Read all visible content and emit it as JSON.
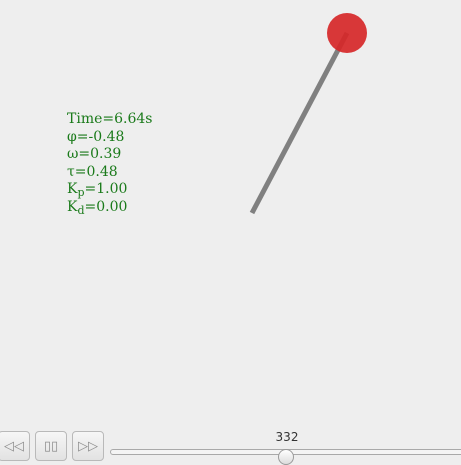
{
  "simulation": {
    "time": "Time=6.64s",
    "phi": "φ=-0.48",
    "omega": "ω=0.39",
    "tau": "τ=0.48",
    "kp_label": "K",
    "kp_sub": "p",
    "kp_value": "=1.00",
    "kd_label": "K",
    "kd_sub": "d",
    "kd_value": "=0.00",
    "text_color": "#1a7a1a",
    "rod_color": "#808080",
    "bob_color": "#d62728"
  },
  "controls": {
    "rewind_icon": "rewind-icon",
    "pause_icon": "pause-icon",
    "forward_icon": "fast-forward-icon",
    "rewind_glyph": "◁◁",
    "pause_glyph": "▯▯",
    "forward_glyph": "▷▷",
    "step": "332"
  }
}
